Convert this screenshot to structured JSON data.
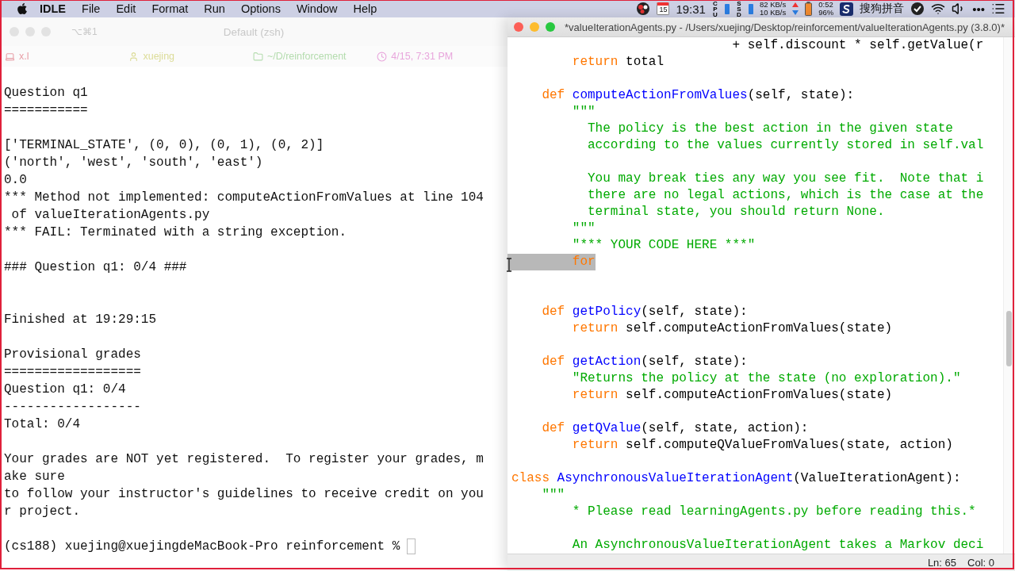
{
  "menu_bar": {
    "app": "IDLE",
    "menus": [
      "File",
      "Edit",
      "Format",
      "Run",
      "Options",
      "Window",
      "Help"
    ],
    "status": {
      "calendar_day": "15",
      "time": "19:31",
      "cpu_label": "CPU",
      "ssd_label": "SSD",
      "upload": "82 KB/s",
      "download": "10 KB/s",
      "battery_time": "0:52",
      "battery_percent": "96%",
      "input_method": "搜狗拼音",
      "more": "•••"
    }
  },
  "terminal": {
    "shortcut": "⌥⌘1",
    "title": "Default (zsh)",
    "status_items": [
      {
        "kind": "host",
        "text": "x.l",
        "color": "#e8a0a8"
      },
      {
        "kind": "user",
        "text": "xuejing",
        "color": "#dcdc98"
      },
      {
        "kind": "folder",
        "text": "~/D/reinforcement",
        "color": "#b4dcae"
      },
      {
        "kind": "clock",
        "text": "4/15, 7:31 PM",
        "color": "#e8a6dc"
      }
    ],
    "lines": [
      {
        "kind": "text",
        "text": "Question q1"
      },
      {
        "kind": "text",
        "text": "==========="
      },
      {
        "kind": "blank"
      },
      {
        "kind": "text",
        "text": "['TERMINAL_STATE', (0, 0), (0, 1), (0, 2)]"
      },
      {
        "kind": "text",
        "text": "('north', 'west', 'south', 'east')"
      },
      {
        "kind": "text",
        "text": "0.0"
      },
      {
        "kind": "text",
        "text": "*** Method not implemented: computeActionFromValues at line 104"
      },
      {
        "kind": "text",
        "text": " of valueIterationAgents.py"
      },
      {
        "kind": "text",
        "text": "*** FAIL: Terminated with a string exception."
      },
      {
        "kind": "blank"
      },
      {
        "kind": "text",
        "text": "### Question q1: 0/4 ###"
      },
      {
        "kind": "blank"
      },
      {
        "kind": "blank"
      },
      {
        "kind": "text",
        "text": "Finished at 19:29:15"
      },
      {
        "kind": "blank"
      },
      {
        "kind": "text",
        "text": "Provisional grades"
      },
      {
        "kind": "text",
        "text": "=================="
      },
      {
        "kind": "text",
        "text": "Question q1: 0/4"
      },
      {
        "kind": "text",
        "text": "------------------"
      },
      {
        "kind": "text",
        "text": "Total: 0/4"
      },
      {
        "kind": "blank"
      },
      {
        "kind": "text",
        "text": "Your grades are NOT yet registered.  To register your grades, m"
      },
      {
        "kind": "text",
        "text": "ake sure"
      },
      {
        "kind": "text",
        "text": "to follow your instructor's guidelines to receive credit on you"
      },
      {
        "kind": "text",
        "text": "r project."
      },
      {
        "kind": "blank"
      },
      {
        "kind": "prompt",
        "text": "(cs188) xuejing@xuejingdeMacBook-Pro reinforcement %"
      }
    ]
  },
  "editor": {
    "title": "*valueIterationAgents.py - /Users/xuejing/Desktop/reinforcement/valueIterationAgents.py (3.8.0)*",
    "lines": [
      {
        "kind": "code",
        "selected": false,
        "tokens": [
          {
            "kind": "plain",
            "text": "                             + self.discount * self.getValue(r"
          }
        ]
      },
      {
        "kind": "code",
        "selected": false,
        "tokens": [
          {
            "kind": "keyword",
            "text": "        return"
          },
          {
            "kind": "plain",
            "text": " total"
          }
        ]
      },
      {
        "kind": "blank"
      },
      {
        "kind": "code",
        "selected": false,
        "tokens": [
          {
            "kind": "keyword",
            "text": "    def "
          },
          {
            "kind": "defname",
            "text": "computeActionFromValues"
          },
          {
            "kind": "plain",
            "text": "(self, state):"
          }
        ]
      },
      {
        "kind": "code",
        "selected": false,
        "tokens": [
          {
            "kind": "string",
            "text": "        \"\"\""
          }
        ]
      },
      {
        "kind": "code",
        "selected": false,
        "tokens": [
          {
            "kind": "string",
            "text": "          The policy is the best action in the given state"
          }
        ]
      },
      {
        "kind": "code",
        "selected": false,
        "tokens": [
          {
            "kind": "string",
            "text": "          according to the values currently stored in self.val"
          }
        ]
      },
      {
        "kind": "blank"
      },
      {
        "kind": "code",
        "selected": false,
        "tokens": [
          {
            "kind": "string",
            "text": "          You may break ties any way you see fit.  Note that i"
          }
        ]
      },
      {
        "kind": "code",
        "selected": false,
        "tokens": [
          {
            "kind": "string",
            "text": "          there are no legal actions, which is the case at the"
          }
        ]
      },
      {
        "kind": "code",
        "selected": false,
        "tokens": [
          {
            "kind": "string",
            "text": "          terminal state, you should return None."
          }
        ]
      },
      {
        "kind": "code",
        "selected": false,
        "tokens": [
          {
            "kind": "string",
            "text": "        \"\"\""
          }
        ]
      },
      {
        "kind": "code",
        "selected": false,
        "tokens": [
          {
            "kind": "string",
            "text": "        \"*** YOUR CODE HERE ***\""
          }
        ]
      },
      {
        "kind": "code",
        "selected": true,
        "tokens": [
          {
            "kind": "keyword",
            "text": "        for"
          }
        ]
      },
      {
        "kind": "blank"
      },
      {
        "kind": "blank"
      },
      {
        "kind": "code",
        "selected": false,
        "tokens": [
          {
            "kind": "keyword",
            "text": "    def "
          },
          {
            "kind": "defname",
            "text": "getPolicy"
          },
          {
            "kind": "plain",
            "text": "(self, state):"
          }
        ]
      },
      {
        "kind": "code",
        "selected": false,
        "tokens": [
          {
            "kind": "keyword",
            "text": "        return"
          },
          {
            "kind": "plain",
            "text": " self.computeActionFromValues(state)"
          }
        ]
      },
      {
        "kind": "blank"
      },
      {
        "kind": "code",
        "selected": false,
        "tokens": [
          {
            "kind": "keyword",
            "text": "    def "
          },
          {
            "kind": "defname",
            "text": "getAction"
          },
          {
            "kind": "plain",
            "text": "(self, state):"
          }
        ]
      },
      {
        "kind": "code",
        "selected": false,
        "tokens": [
          {
            "kind": "string",
            "text": "        \"Returns the policy at the state (no exploration).\""
          }
        ]
      },
      {
        "kind": "code",
        "selected": false,
        "tokens": [
          {
            "kind": "keyword",
            "text": "        return"
          },
          {
            "kind": "plain",
            "text": " self.computeActionFromValues(state)"
          }
        ]
      },
      {
        "kind": "blank"
      },
      {
        "kind": "code",
        "selected": false,
        "tokens": [
          {
            "kind": "keyword",
            "text": "    def "
          },
          {
            "kind": "defname",
            "text": "getQValue"
          },
          {
            "kind": "plain",
            "text": "(self, state, action):"
          }
        ]
      },
      {
        "kind": "code",
        "selected": false,
        "tokens": [
          {
            "kind": "keyword",
            "text": "        return"
          },
          {
            "kind": "plain",
            "text": " self.computeQValueFromValues(state, action)"
          }
        ]
      },
      {
        "kind": "blank"
      },
      {
        "kind": "code",
        "selected": false,
        "tokens": [
          {
            "kind": "keyword",
            "text": "class "
          },
          {
            "kind": "defname",
            "text": "AsynchronousValueIterationAgent"
          },
          {
            "kind": "plain",
            "text": "(ValueIterationAgent):"
          }
        ]
      },
      {
        "kind": "code",
        "selected": false,
        "tokens": [
          {
            "kind": "string",
            "text": "    \"\"\""
          }
        ]
      },
      {
        "kind": "code",
        "selected": false,
        "tokens": [
          {
            "kind": "string",
            "text": "        * Please read learningAgents.py before reading this.*"
          }
        ]
      },
      {
        "kind": "blank"
      },
      {
        "kind": "code",
        "selected": false,
        "tokens": [
          {
            "kind": "string",
            "text": "        An AsynchronousValueIterationAgent takes a Markov deci"
          }
        ]
      }
    ],
    "status": {
      "line": "Ln: 65",
      "col": "Col: 0"
    }
  }
}
